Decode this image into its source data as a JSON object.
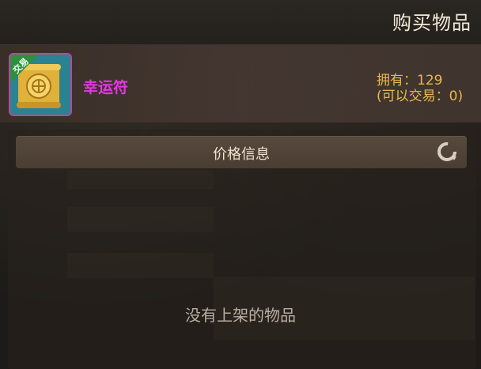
{
  "window": {
    "title": "购买物品"
  },
  "item": {
    "name": "幸运符",
    "badge": "交易",
    "owned": "拥有：129",
    "tradable": "(可以交易：0)",
    "name_color": "#e637e6",
    "count_color": "#e8b94a"
  },
  "price_panel": {
    "label": "价格信息",
    "refresh_icon": "refresh-icon"
  },
  "listing": {
    "empty_message": "没有上架的物品"
  }
}
